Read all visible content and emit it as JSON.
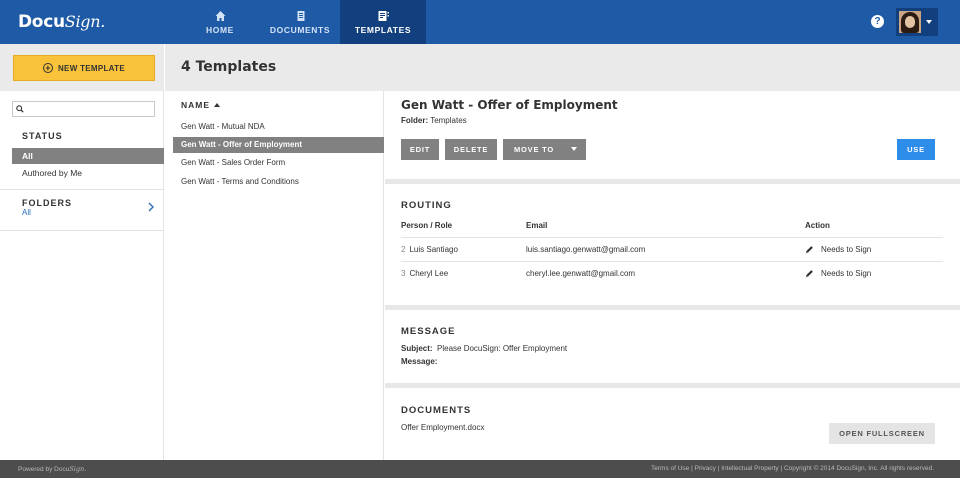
{
  "app": {
    "logo_word": "Docu",
    "logo_script": "Sign.",
    "colors": {
      "brand": "#1f5aa6",
      "nav_active": "#123f7e",
      "accent_yellow": "#f8c23a",
      "use_blue": "#2e8de8",
      "selected_gray": "#818181"
    }
  },
  "nav": {
    "items": [
      {
        "label": "HOME",
        "icon": "home-icon"
      },
      {
        "label": "DOCUMENTS",
        "icon": "documents-icon"
      },
      {
        "label": "TEMPLATES",
        "icon": "templates-icon",
        "active": true
      }
    ],
    "help_glyph": "?"
  },
  "sidebar": {
    "new_template_label": "NEW TEMPLATE",
    "search_placeholder": "",
    "status_label": "STATUS",
    "status_items": [
      "All",
      "Authored by Me"
    ],
    "folders_label": "FOLDERS",
    "folders_value": "All"
  },
  "header": {
    "title": "4 Templates"
  },
  "list": {
    "column_label": "NAME",
    "items": [
      "Gen Watt - Mutual NDA",
      "Gen Watt - Offer of Employment",
      "Gen Watt - Sales Order Form",
      "Gen Watt - Terms and Conditions"
    ],
    "selected_index": 1
  },
  "detail": {
    "title": "Gen Watt - Offer of Employment",
    "folder_label": "Folder:",
    "folder_value": "Templates",
    "buttons": {
      "edit": "EDIT",
      "delete": "DELETE",
      "move_to": "MOVE TO",
      "use": "USE"
    },
    "routing": {
      "title": "ROUTING",
      "headers": {
        "person": "Person / Role",
        "email": "Email",
        "action": "Action"
      },
      "rows": [
        {
          "order": "2",
          "name": "Luis Santiago",
          "email": "luis.santiago.genwatt@gmail.com",
          "action": "Needs to Sign"
        },
        {
          "order": "3",
          "name": "Cheryl Lee",
          "email": "cheryl.lee.genwatt@gmail.com",
          "action": "Needs to Sign"
        }
      ]
    },
    "message": {
      "title": "MESSAGE",
      "subject_label": "Subject:",
      "subject_value": "Please DocuSign: Offer Employment",
      "message_label": "Message:"
    },
    "documents": {
      "title": "DOCUMENTS",
      "files": [
        "Offer Employment.docx"
      ],
      "open_fullscreen": "OPEN FULLSCREEN"
    }
  },
  "footer": {
    "powered_by": "Powered by",
    "powered_logo_word": "Docu",
    "powered_logo_script": "Sign.",
    "links": "Terms of Use | Privacy | Intellectual Property | Copyright © 2014 DocuSign, Inc. All rights reserved."
  }
}
